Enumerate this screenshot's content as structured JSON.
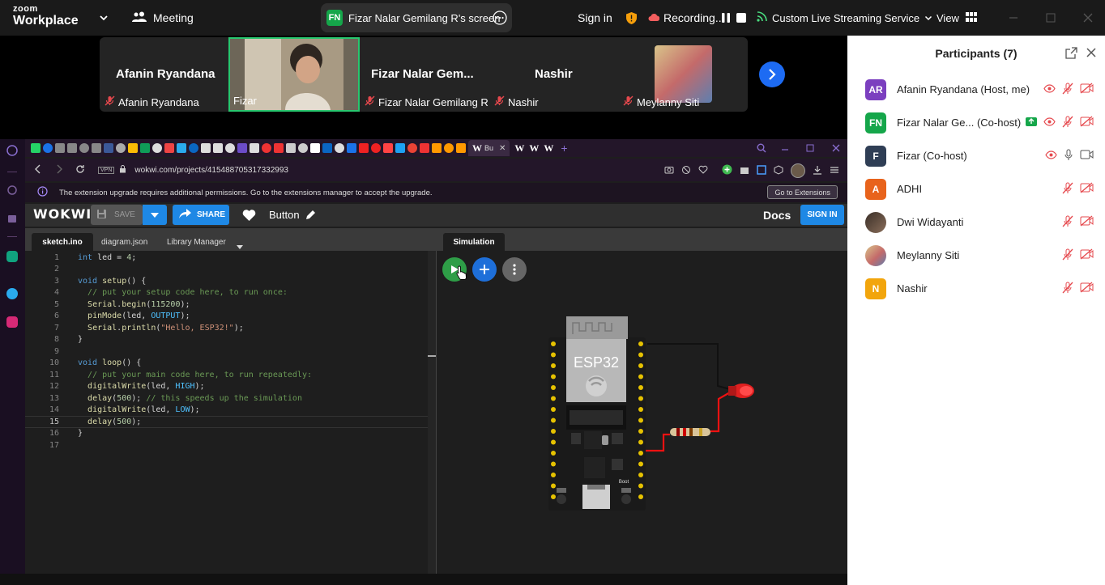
{
  "zoom": {
    "logo_line1": "zoom",
    "logo_line2": "Workplace",
    "meeting_label": "Meeting",
    "share_badge": "FN",
    "share_label": "Fizar Nalar Gemilang R's screen",
    "signin": "Sign in",
    "recording": "Recording...",
    "streaming": "Custom Live Streaming Service",
    "view": "View"
  },
  "gallery": [
    {
      "big": "Afanin Ryandana",
      "small": "Afanin Ryandana"
    },
    {
      "big": "",
      "small": "Fizar"
    },
    {
      "big": "Fizar Nalar Gem...",
      "small": "Fizar Nalar Gemilang R"
    },
    {
      "big": "Nashir",
      "small": "Nashir"
    },
    {
      "big": "",
      "small": "Meylanny Siti"
    }
  ],
  "participants": {
    "title": "Participants (7)",
    "list": [
      {
        "initials": "AR",
        "name": "Afanin Ryandana (Host, me)",
        "color": "#7b3fbf"
      },
      {
        "initials": "FN",
        "name": "Fizar Nalar Ge... (Co-host)",
        "color": "#15a64a"
      },
      {
        "initials": "F",
        "name": "Fizar (Co-host)",
        "color": "#2f3e55"
      },
      {
        "initials": "A",
        "name": "ADHI",
        "color": "#e8631c"
      },
      {
        "initials": "",
        "name": "Dwi Widayanti",
        "color": "#6a5a4a"
      },
      {
        "initials": "",
        "name": "Meylanny Siti",
        "color": "#c7a15b"
      },
      {
        "initials": "N",
        "name": "Nashir",
        "color": "#f2a50c"
      }
    ]
  },
  "browser": {
    "active_tab": "Bu",
    "url": "wokwi.com/projects/415488705317332993",
    "vpn": "VPN",
    "extension_msg": "The extension upgrade requires additional permissions. Go to the extensions manager to accept the upgrade.",
    "extension_button": "Go to Extensions"
  },
  "wokwi": {
    "logo": "WOKWI",
    "save": "SAVE",
    "share": "SHARE",
    "project": "Button",
    "docs": "Docs",
    "signin": "SIGN IN",
    "tabs": [
      "sketch.ino",
      "diagram.json",
      "Library Manager"
    ],
    "sim_tab": "Simulation",
    "chip": "ESP32",
    "boot": "Boot"
  },
  "code": [
    "int led = 4;",
    "",
    "void setup() {",
    "  // put your setup code here, to run once:",
    "  Serial.begin(115200);",
    "  pinMode(led, OUTPUT);",
    "  Serial.println(\"Hello, ESP32!\");",
    "}",
    "",
    "void loop() {",
    "  // put your main code here, to run repeatedly:",
    "  digitalWrite(led, HIGH);",
    "  delay(500); // this speeds up the simulation",
    "  digitalWrite(led, LOW);",
    "  delay(500);",
    "}",
    ""
  ],
  "colors": {
    "zoom_blue": "#1d6bf3",
    "active_green": "#28c76f",
    "wokwi_blue": "#0077cc"
  }
}
